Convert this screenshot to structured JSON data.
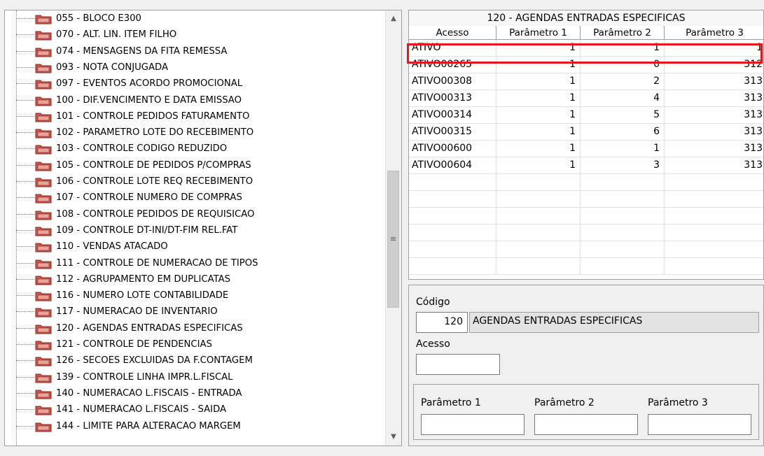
{
  "tree": {
    "items": [
      {
        "label": "055 - BLOCO E300"
      },
      {
        "label": "070 - ALT. LIN. ITEM FILHO"
      },
      {
        "label": "074 - MENSAGENS DA FITA REMESSA"
      },
      {
        "label": "093 - NOTA CONJUGADA"
      },
      {
        "label": "097 - EVENTOS ACORDO PROMOCIONAL"
      },
      {
        "label": "100 - DIF.VENCIMENTO E DATA EMISSAO"
      },
      {
        "label": "101 - CONTROLE PEDIDOS FATURAMENTO"
      },
      {
        "label": "102 - PARAMETRO LOTE DO RECEBIMENTO"
      },
      {
        "label": "103 - CONTROLE CODIGO REDUZIDO"
      },
      {
        "label": "105 - CONTROLE DE PEDIDOS P/COMPRAS"
      },
      {
        "label": "106 - CONTROLE LOTE REQ RECEBIMENTO"
      },
      {
        "label": "107 - CONTROLE NUMERO DE COMPRAS"
      },
      {
        "label": "108 - CONTROLE PEDIDOS DE REQUISICAO"
      },
      {
        "label": "109 - CONTROLE DT-INI/DT-FIM REL.FAT"
      },
      {
        "label": "110 - VENDAS ATACADO"
      },
      {
        "label": "111 - CONTROLE DE NUMERACAO DE TIPOS"
      },
      {
        "label": "112 - AGRUPAMENTO EM DUPLICATAS"
      },
      {
        "label": "116 - NUMERO LOTE CONTABILIDADE"
      },
      {
        "label": "117 - NUMERACAO DE INVENTARIO"
      },
      {
        "label": "120 - AGENDAS ENTRADAS ESPECIFICAS"
      },
      {
        "label": "121 - CONTROLE DE PENDENCIAS"
      },
      {
        "label": "126 - SECOES EXCLUIDAS DA F.CONTAGEM"
      },
      {
        "label": "139 - CONTROLE LINHA IMPR.L.FISCAL"
      },
      {
        "label": "140 - NUMERACAO L.FISCAIS - ENTRADA"
      },
      {
        "label": "141 - NUMERACAO L.FISCAIS - SAIDA"
      },
      {
        "label": "144 - LIMITE PARA ALTERACAO MARGEM"
      }
    ]
  },
  "grid": {
    "title": "120 - AGENDAS ENTRADAS ESPECIFICAS",
    "headers": [
      "Acesso",
      "Parâmetro 1",
      "Parâmetro 2",
      "Parâmetro 3"
    ],
    "rows": [
      [
        "ATIVO",
        "1",
        "1",
        "1"
      ],
      [
        "ATIVO00265",
        "1",
        "0",
        "312"
      ],
      [
        "ATIVO00308",
        "1",
        "2",
        "313"
      ],
      [
        "ATIVO00313",
        "1",
        "4",
        "313"
      ],
      [
        "ATIVO00314",
        "1",
        "5",
        "313"
      ],
      [
        "ATIVO00315",
        "1",
        "6",
        "313"
      ],
      [
        "ATIVO00600",
        "1",
        "1",
        "313"
      ],
      [
        "ATIVO00604",
        "1",
        "3",
        "313"
      ]
    ]
  },
  "form": {
    "codigo_label": "Código",
    "codigo_value": "120",
    "descricao_value": "AGENDAS ENTRADAS ESPECIFICAS",
    "acesso_label": "Acesso",
    "acesso_value": "",
    "param1_label": "Parâmetro 1",
    "param2_label": "Parâmetro 2",
    "param3_label": "Parâmetro 3",
    "param1_value": "",
    "param2_value": "",
    "param3_value": ""
  },
  "scrollbar": {
    "up_icon": "▲",
    "down_icon": "▼",
    "grip_icon": "≡"
  },
  "colors": {
    "highlight": "#e8141c",
    "folder": "#c8564a"
  }
}
